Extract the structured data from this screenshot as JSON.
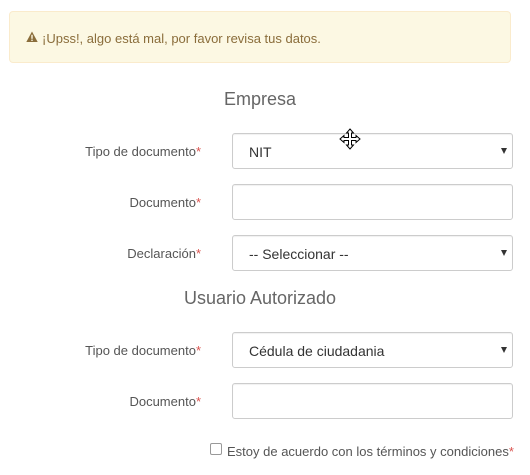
{
  "alert": {
    "icon": "warning-icon",
    "message": "¡Upss!, algo está mal, por favor revisa tus datos.",
    "color": "#8a6d3b",
    "background": "#fcf8e3"
  },
  "empresa": {
    "title": "Empresa",
    "tipo_documento": {
      "label": "Tipo de documento",
      "required_mark": "*",
      "value": "NIT"
    },
    "documento": {
      "label": "Documento",
      "required_mark": "*",
      "value": ""
    },
    "declaracion": {
      "label": "Declaración",
      "required_mark": "*",
      "value": "-- Seleccionar --"
    }
  },
  "usuario": {
    "title": "Usuario Autorizado",
    "tipo_documento": {
      "label": "Tipo de documento",
      "required_mark": "*",
      "value": "Cédula de ciudadania"
    },
    "documento": {
      "label": "Documento",
      "required_mark": "*",
      "value": ""
    }
  },
  "terms": {
    "label": "Estoy de acuerdo con los términos y condiciones",
    "required_mark": "*",
    "checked": false
  },
  "cursor": {
    "icon": "move-cursor-icon"
  },
  "colors": {
    "required": "#d9534f",
    "border": "#cccccc"
  }
}
